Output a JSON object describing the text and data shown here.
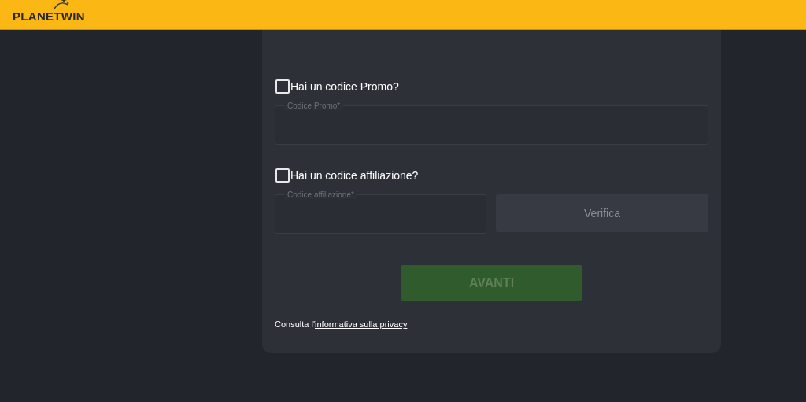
{
  "header": {
    "logo": "PLANETWIN"
  },
  "promo": {
    "checkbox": {
      "label": "Hai un codice Promo?",
      "checked": false
    },
    "field": {
      "label": "Codice Promo*"
    }
  },
  "affiliate": {
    "checkbox": {
      "label": "Hai un codice affiliazione?",
      "checked": false
    },
    "field": {
      "label": "Codice affiliazione*"
    },
    "button": {
      "label": "Verifica",
      "disabled": true
    }
  },
  "submit": {
    "label": "AVANTI",
    "disabled": true
  },
  "privacy": {
    "text": "Consulta l'",
    "link": "informativa sulla privacy"
  }
}
